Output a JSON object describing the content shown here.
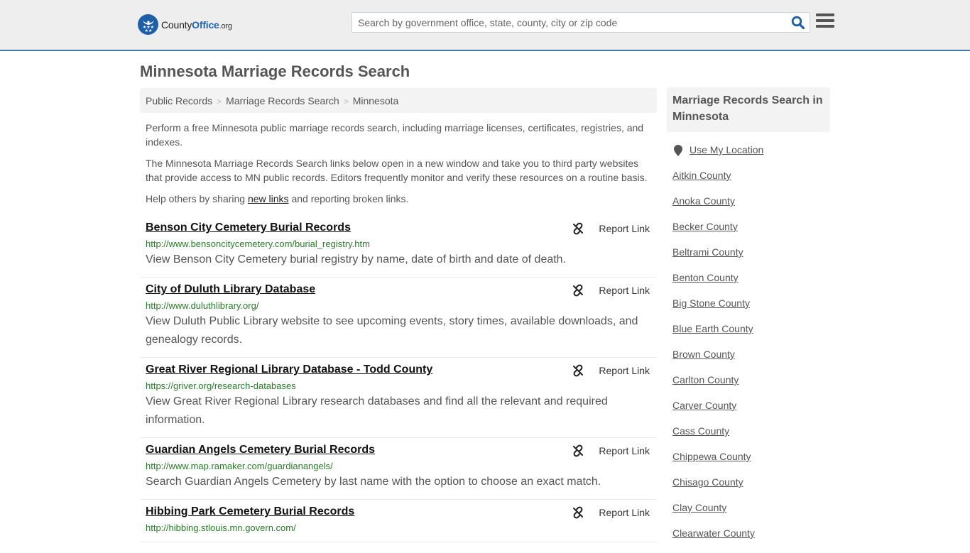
{
  "header": {
    "logo": {
      "county": "County",
      "office": "Office",
      "org": ".org"
    },
    "search": {
      "placeholder": "Search by government office, state, county, city or zip code",
      "value": ""
    },
    "icons": {
      "search": "search-icon",
      "menu": "hamburger-menu-icon"
    },
    "colors": {
      "brand": "#1f64b4",
      "accent_border": "#3a7bb0"
    }
  },
  "page": {
    "title": "Minnesota Marriage Records Search",
    "breadcrumb": [
      {
        "label": "Public Records"
      },
      {
        "label": "Marriage Records Search"
      },
      {
        "label": "Minnesota"
      }
    ],
    "breadcrumb_separator": ">",
    "intro": {
      "p1": "Perform a free Minnesota public marriage records search, including marriage licenses, certificates, registries, and indexes.",
      "p2": "The Minnesota Marriage Records Search links below open in a new window and take you to third party websites that provide access to MN public records. Editors frequently monitor and verify these resources on a routine basis.",
      "p3_before": "Help others by sharing ",
      "p3_link": "new links",
      "p3_after": " and reporting broken links."
    }
  },
  "results": [
    {
      "title": "Benson City Cemetery Burial Records",
      "url": "http://www.bensoncitycemetery.com/burial_registry.htm",
      "description": "View Benson City Cemetery burial registry by name, date of birth and date of death.",
      "report_label": "Report Link"
    },
    {
      "title": "City of Duluth Library Database",
      "url": "http://www.duluthlibrary.org/",
      "description": "View Duluth Public Library website to see upcoming events, story times, available downloads, and genealogy records.",
      "report_label": "Report Link"
    },
    {
      "title": "Great River Regional Library Database - Todd County",
      "url": "https://griver.org/research-databases",
      "description": "View Great River Regional Library research databases and find all the relevant and required information.",
      "report_label": "Report Link"
    },
    {
      "title": "Guardian Angels Cemetery Burial Records",
      "url": "http://www.map.ramaker.com/guardianangels/",
      "description": "Search Guardian Angels Cemetery by last name with the option to choose an exact match.",
      "report_label": "Report Link"
    },
    {
      "title": "Hibbing Park Cemetery Burial Records",
      "url": "http://hibbing.stlouis.mn.govern.com/",
      "description": "",
      "report_label": "Report Link"
    }
  ],
  "sidebar": {
    "title": "Marriage Records Search in Minnesota",
    "use_location": "Use My Location",
    "counties": [
      "Aitkin County",
      "Anoka County",
      "Becker County",
      "Beltrami County",
      "Benton County",
      "Big Stone County",
      "Blue Earth County",
      "Brown County",
      "Carlton County",
      "Carver County",
      "Cass County",
      "Chippewa County",
      "Chisago County",
      "Clay County",
      "Clearwater County"
    ]
  }
}
